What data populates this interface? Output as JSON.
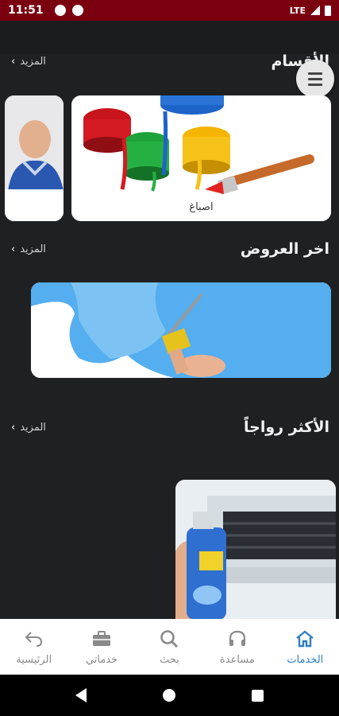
{
  "status_bar": {
    "time": "11:51",
    "network": "LTE"
  },
  "menu_button": {
    "icon": "hamburger-menu-icon"
  },
  "sections": {
    "categories": {
      "title": "الأقسام",
      "more": "المزيد",
      "cards": [
        {
          "label": "اصباغ",
          "image": "paint-buckets-image"
        },
        {
          "label": "",
          "image": "technician-worker-image"
        }
      ]
    },
    "offers": {
      "title": "اخر العروض",
      "more": "المزيد",
      "cards": [
        {
          "image": "paint-roller-wall-image"
        }
      ]
    },
    "popular": {
      "title": "الأكثر رواجاً",
      "more": "المزيد",
      "cards": [
        {
          "image": "ac-cleaning-spray-image"
        }
      ]
    }
  },
  "bottom_nav": {
    "items": [
      {
        "label": "الخدمات",
        "icon": "home-icon",
        "active": true
      },
      {
        "label": "مساعدة",
        "icon": "headphones-icon",
        "active": false
      },
      {
        "label": "بحث",
        "icon": "search-icon",
        "active": false
      },
      {
        "label": "خدماتي",
        "icon": "briefcase-icon",
        "active": false
      },
      {
        "label": "الرئيسية",
        "icon": "back-arrow-icon",
        "active": false
      }
    ]
  },
  "colors": {
    "accent": "#2f7ec1",
    "background": "#1f2022",
    "status_bar": "#7a0010"
  }
}
